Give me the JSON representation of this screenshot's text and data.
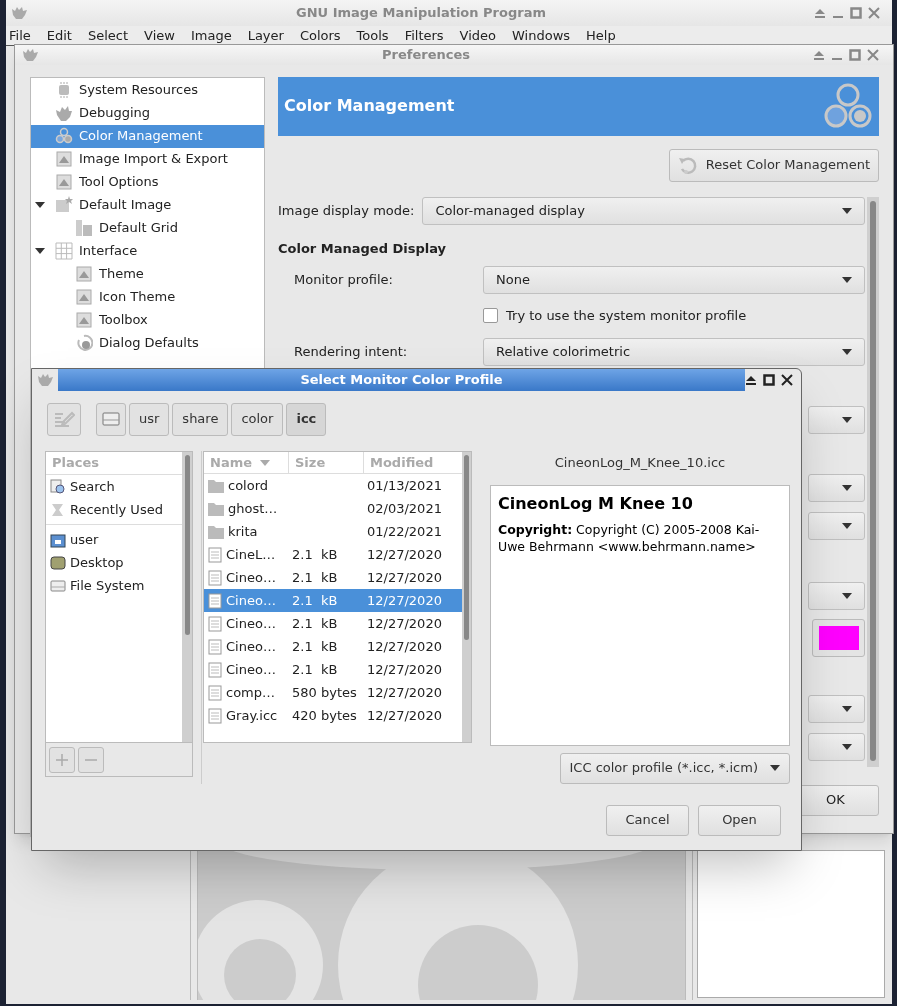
{
  "main_window": {
    "title": "GNU Image Manipulation Program",
    "menu": [
      "File",
      "Edit",
      "Select",
      "View",
      "Image",
      "Layer",
      "Colors",
      "Tools",
      "Filters",
      "Video",
      "Windows",
      "Help"
    ]
  },
  "preferences": {
    "title": "Preferences",
    "tree": [
      {
        "label": "System Resources",
        "selected": false
      },
      {
        "label": "Debugging",
        "selected": false
      },
      {
        "label": "Color Management",
        "selected": true
      },
      {
        "label": "Image Import & Export",
        "selected": false
      },
      {
        "label": "Tool Options",
        "selected": false
      },
      {
        "label": "Default Image",
        "selected": false,
        "expanded": true,
        "children": [
          {
            "label": "Default Grid",
            "selected": false
          }
        ]
      },
      {
        "label": "Interface",
        "selected": false,
        "expanded": true,
        "children": [
          {
            "label": "Theme",
            "selected": false
          },
          {
            "label": "Icon Theme",
            "selected": false
          },
          {
            "label": "Toolbox",
            "selected": false
          },
          {
            "label": "Dialog Defaults",
            "selected": false
          }
        ]
      }
    ],
    "header": "Color Management",
    "reset_button": "Reset Color Management",
    "display_mode": {
      "label": "Image display mode:",
      "value": "Color-managed display"
    },
    "section": {
      "heading": "Color Managed Display",
      "monitor_profile": {
        "label": "Monitor profile:",
        "value": "None"
      },
      "system_profile_checkbox": {
        "label": "Try to use the system monitor profile",
        "checked": false
      },
      "rendering_intent": {
        "label": "Rendering intent:",
        "value": "Relative colorimetric"
      }
    },
    "more_rows": [
      {
        "kind": "dropdown"
      },
      {
        "kind": "dropdown"
      },
      {
        "kind": "dropdown"
      },
      {
        "kind": "dropdown"
      },
      {
        "kind": "color",
        "color": "#ff00ff"
      },
      {
        "kind": "dropdown"
      },
      {
        "kind": "dropdown"
      }
    ],
    "ok_button": "OK"
  },
  "dialog": {
    "title": "Select Monitor Color Profile",
    "path": [
      {
        "label": "usr",
        "selected": false
      },
      {
        "label": "share",
        "selected": false
      },
      {
        "label": "color",
        "selected": false
      },
      {
        "label": "icc",
        "selected": true
      }
    ],
    "places_header": "Places",
    "places_groups": [
      {
        "items": [
          {
            "label": "Search"
          },
          {
            "label": "Recently Used"
          }
        ]
      },
      {
        "items": [
          {
            "label": "user"
          },
          {
            "label": "Desktop"
          },
          {
            "label": "File System"
          }
        ]
      }
    ],
    "columns": [
      {
        "label": "Name",
        "sorted": true
      },
      {
        "label": "Size",
        "sorted": false
      },
      {
        "label": "Modified",
        "sorted": false
      }
    ],
    "files": [
      {
        "kind": "folder",
        "name": "colord",
        "modified": "01/13/2021",
        "selected": false
      },
      {
        "kind": "folder",
        "name": "ghost…",
        "modified": "02/03/2021",
        "selected": false
      },
      {
        "kind": "folder",
        "name": "krita",
        "modified": "01/22/2021",
        "selected": false
      },
      {
        "kind": "file",
        "name": "CineL…",
        "size": "2.1  kB",
        "modified": "12/27/2020",
        "selected": false
      },
      {
        "kind": "file",
        "name": "Cineo…",
        "size": "2.1  kB",
        "modified": "12/27/2020",
        "selected": false
      },
      {
        "kind": "file",
        "name": "Cineo…",
        "size": "2.1  kB",
        "modified": "12/27/2020",
        "selected": true
      },
      {
        "kind": "file",
        "name": "Cineo…",
        "size": "2.1  kB",
        "modified": "12/27/2020",
        "selected": false
      },
      {
        "kind": "file",
        "name": "Cineo…",
        "size": "2.1  kB",
        "modified": "12/27/2020",
        "selected": false
      },
      {
        "kind": "file",
        "name": "Cineo…",
        "size": "2.1  kB",
        "modified": "12/27/2020",
        "selected": false
      },
      {
        "kind": "file",
        "name": "comp…",
        "size": "580 bytes",
        "modified": "12/27/2020",
        "selected": false
      },
      {
        "kind": "file",
        "name": "Gray.icc",
        "size": "420 bytes",
        "modified": "12/27/2020",
        "selected": false
      }
    ],
    "preview": {
      "filename": "CineonLog_M_Knee_10.icc",
      "title": "CineonLog M Knee 10",
      "description": "**Copyright:** Copyright (C) 2005-2008 Kai-Uwe Behrmann <www.behrmann.name>"
    },
    "filter": "ICC color profile (*.icc, *.icm)",
    "buttons": [
      {
        "label": "Cancel"
      },
      {
        "label": "Open"
      }
    ]
  }
}
